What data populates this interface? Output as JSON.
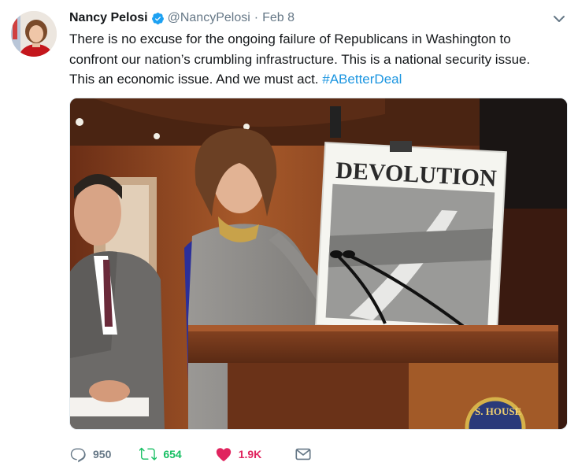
{
  "tweet": {
    "author_name": "Nancy Pelosi",
    "handle": "@NancyPelosi",
    "separator": "·",
    "date": "Feb 8",
    "text_line1": "There is no excuse for the ongoing failure of Republicans in Washington to",
    "text_line2": "confront our nation’s crumbling infrastructure. This is a national security issue.",
    "text_line3_prefix": "This an economic issue. And we must act. ",
    "hashtag": "#ABetterDeal",
    "image": {
      "sign_text": "DEVOLUTION",
      "seal_text": "S. HOUSE"
    }
  },
  "actions": {
    "replies": "950",
    "retweets": "654",
    "likes": "1.9K"
  },
  "icons": {
    "verified": "verified-badge-icon",
    "caret": "chevron-down-icon",
    "reply": "reply-icon",
    "retweet": "retweet-icon",
    "like": "heart-icon",
    "dm": "envelope-icon"
  },
  "colors": {
    "link": "#1b95e0",
    "secondary": "#657786",
    "retweet_active": "#17bf63",
    "like_active": "#e0245e"
  }
}
